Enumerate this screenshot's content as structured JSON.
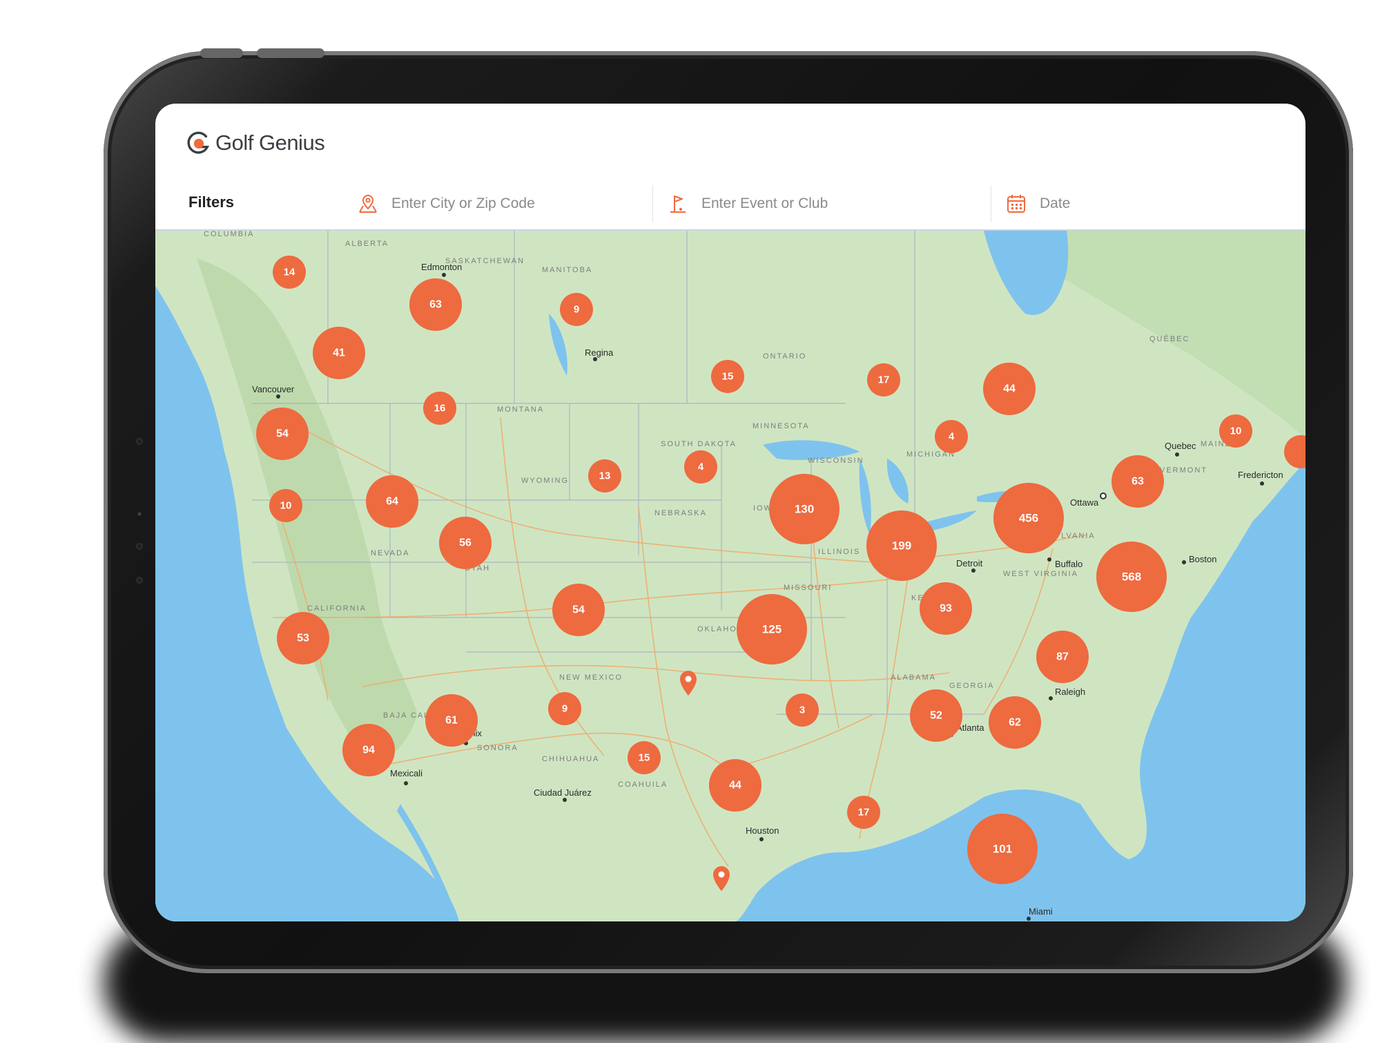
{
  "brand": {
    "name": "Golf Genius",
    "accent": "#ee6a3f"
  },
  "filters": {
    "label": "Filters",
    "city_placeholder": "Enter City or Zip Code",
    "event_placeholder": "Enter Event or Club",
    "date_label": "Date"
  },
  "map": {
    "cities": [
      "Edmonton",
      "Regina",
      "Vancouver",
      "Quebec",
      "Fredericton",
      "Ottawa",
      "Detroit",
      "Buffalo",
      "Boston",
      "Raleigh",
      "Atlanta",
      "Phoenix",
      "Mexicali",
      "Ciudad Juárez",
      "Houston",
      "Miami"
    ],
    "regions": [
      "ALBERTA",
      "SASKATCHEWAN",
      "MANITOBA",
      "ONTARIO",
      "QUÉBEC",
      "MONTANA",
      "MINNESOTA",
      "SOUTH DAKOTA",
      "WYOMING",
      "NEBRASKA",
      "IOWA",
      "WISCONSIN",
      "MICHIGAN",
      "NEVADA",
      "UTAH",
      "CALIFORNIA",
      "ILLINOIS",
      "MISSOURI",
      "OKLAHOMA",
      "NEW MEXICO",
      "PENNSYLVANIA",
      "WEST VIRGINIA",
      "KENTUCKY",
      "ALABAMA",
      "GEORGIA",
      "VERMONT",
      "MAINE",
      "BAJA CALIFORNIA",
      "SONORA",
      "CHIHUAHUA",
      "COAHUILA",
      "COLUMBIA"
    ],
    "clusters": [
      "14",
      "63",
      "9",
      "41",
      "15",
      "17",
      "44",
      "16",
      "54",
      "10",
      "4",
      "13",
      "4",
      "10",
      "63",
      "64",
      "130",
      "456",
      "56",
      "199",
      "568",
      "10",
      "54",
      "93",
      "125",
      "53",
      "87",
      "61",
      "9",
      "3",
      "52",
      "62",
      "94",
      "15",
      "44",
      "17",
      "101"
    ]
  }
}
